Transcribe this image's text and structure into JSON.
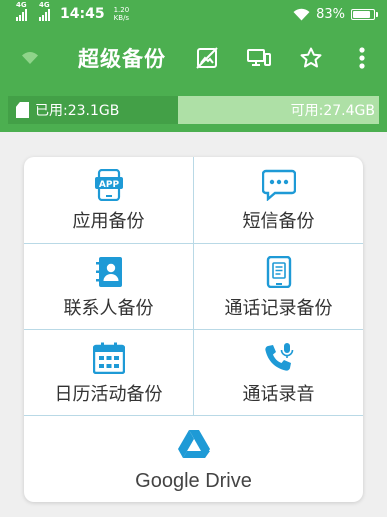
{
  "status_bar": {
    "network_1": "4G",
    "network_2": "4G",
    "time": "14:45",
    "speed_value": "1.20",
    "speed_unit": "KB/s",
    "battery_percent": "83%",
    "battery_level": 0.83
  },
  "toolbar": {
    "title": "超级备份",
    "left_icon": "wifi-icon",
    "actions": [
      "no-image-icon",
      "devices-icon",
      "star-icon",
      "more-vert-icon"
    ]
  },
  "storage": {
    "used_label": "已用:23.1GB",
    "free_label": "可用:27.4GB",
    "used_fraction": 0.457
  },
  "menu": {
    "items": [
      {
        "label": "应用备份",
        "icon": "app-icon"
      },
      {
        "label": "短信备份",
        "icon": "sms-icon"
      },
      {
        "label": "联系人备份",
        "icon": "contacts-icon"
      },
      {
        "label": "通话记录备份",
        "icon": "call-log-icon"
      },
      {
        "label": "日历活动备份",
        "icon": "calendar-icon"
      },
      {
        "label": "通话录音",
        "icon": "call-record-icon"
      }
    ],
    "google_drive": {
      "label": "Google Drive",
      "icon": "google-drive-icon"
    }
  },
  "colors": {
    "primary": "#4caf50",
    "accent_blue": "#1e9ad6"
  }
}
